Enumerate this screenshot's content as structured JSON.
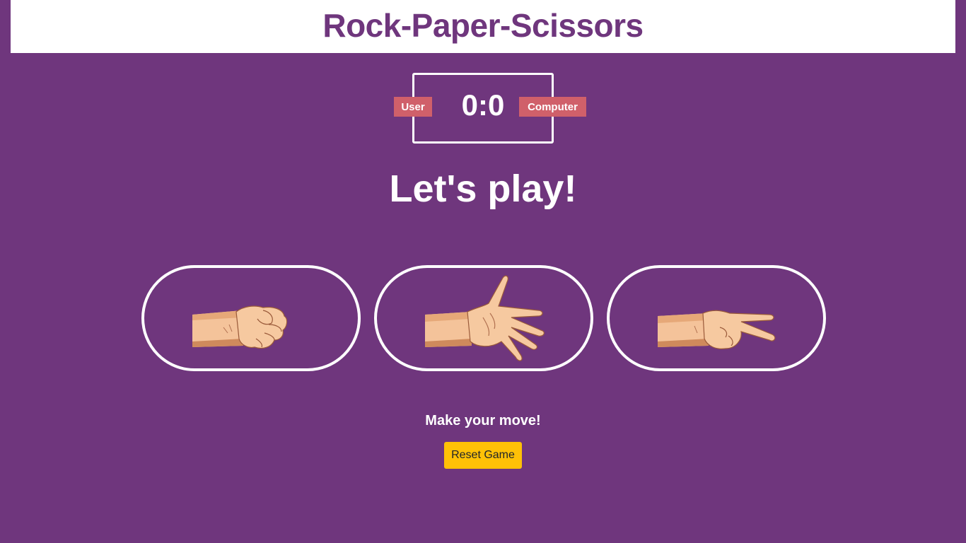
{
  "header": {
    "title": "Rock-Paper-Scissors"
  },
  "scoreboard": {
    "user_label": "User",
    "computer_label": "Computer",
    "user_score": 0,
    "computer_score": 0,
    "score_text": "0:0"
  },
  "prompt": {
    "heading": "Let's play!"
  },
  "choices": [
    {
      "name": "rock",
      "icon": "rock-hand-icon"
    },
    {
      "name": "paper",
      "icon": "paper-hand-icon"
    },
    {
      "name": "scissors",
      "icon": "scissors-hand-icon"
    }
  ],
  "status": {
    "message": "Make your move!"
  },
  "controls": {
    "reset_label": "Reset Game"
  },
  "colors": {
    "background": "#6f367d",
    "header_bg": "#ffffff",
    "badge": "#d0606a",
    "reset_button": "#ffc107",
    "skin": "#f4c39a",
    "skin_shadow": "#d9976a"
  }
}
